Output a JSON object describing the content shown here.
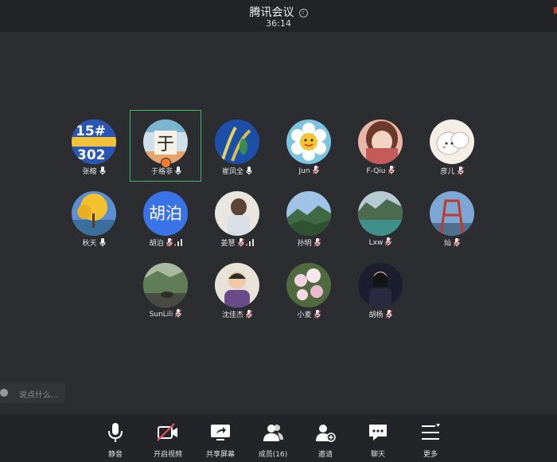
{
  "window": {
    "title": "腾讯会议",
    "timer": "36:14"
  },
  "participants": [
    {
      "name": "张榕",
      "mic": "on"
    },
    {
      "name": "于格非",
      "mic": "on",
      "active": true,
      "host": true
    },
    {
      "name": "崔凤全",
      "mic": "on"
    },
    {
      "name": "Jun",
      "mic": "muted"
    },
    {
      "name": "F-Qiu",
      "mic": "muted"
    },
    {
      "name": "彦儿",
      "mic": "muted"
    },
    {
      "name": "秋天",
      "mic": "on"
    },
    {
      "name": "胡泊",
      "mic": "muted",
      "signal": true,
      "avatar_text": "胡泊"
    },
    {
      "name": "姜慧",
      "mic": "muted",
      "signal": true
    },
    {
      "name": "孙明",
      "mic": "muted"
    },
    {
      "name": "Lxw",
      "mic": "muted"
    },
    {
      "name": "灿",
      "mic": "muted"
    },
    {
      "name": "SunLili",
      "mic": "muted"
    },
    {
      "name": "沈佳杰",
      "mic": "muted"
    },
    {
      "name": "小麦",
      "mic": "muted"
    },
    {
      "name": "胡杨",
      "mic": "muted"
    }
  ],
  "chat": {
    "placeholder": "说点什么..."
  },
  "toolbar": {
    "mute": "静音",
    "video": "开启视频",
    "share": "共享屏幕",
    "members": "成员(16)",
    "invite": "邀请",
    "chat": "聊天",
    "more": "更多"
  },
  "colors": {
    "background": "#2b2d31",
    "bar": "#232427",
    "active_border": "#46b565",
    "mute_red": "#e55353",
    "avatar_blue": "#3a73e8"
  }
}
